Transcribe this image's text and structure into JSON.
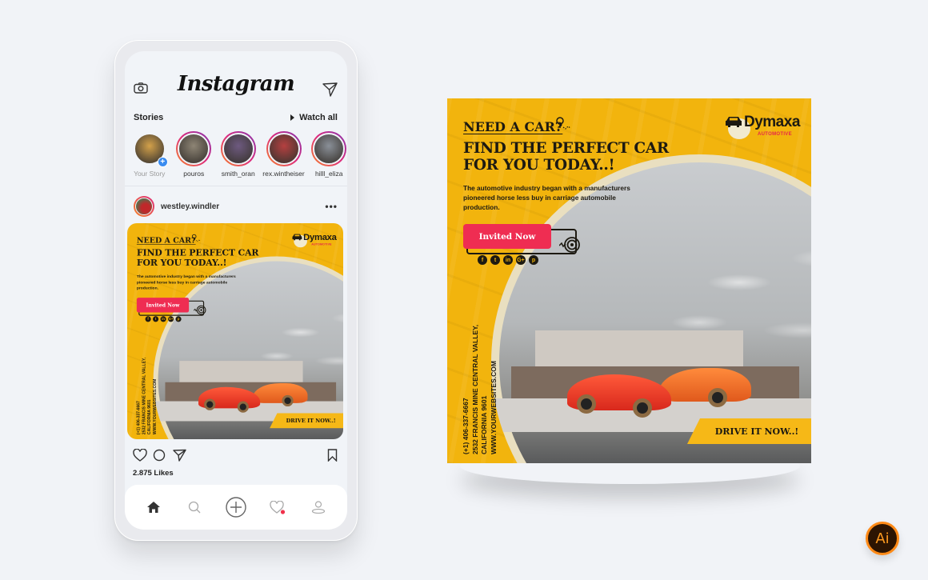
{
  "instagram": {
    "app_title": "Instagram",
    "stories_label": "Stories",
    "watch_all_label": "Watch all",
    "stories": [
      {
        "name": "Your Story",
        "own": true,
        "color": "#d3a14a"
      },
      {
        "name": "pouros",
        "own": false,
        "color": "#8e8575"
      },
      {
        "name": "smith_oran",
        "own": false,
        "color": "#6e5a80"
      },
      {
        "name": "rex.wintheiser",
        "own": false,
        "color": "#b54040"
      },
      {
        "name": "hilll_eliza",
        "own": false,
        "color": "#8a9098"
      }
    ],
    "post": {
      "username": "westley.windler",
      "more_label": "•••",
      "likes": "2.875 Likes"
    },
    "tabbar": [
      "home",
      "search",
      "new-post",
      "activity",
      "profile"
    ]
  },
  "design": {
    "heading_small": "NEED A CAR?",
    "heading_big_line1": "FIND THE PERFECT CAR",
    "heading_big_line2": "FOR YOU TODAY..!",
    "description": "The automotive industry began with a manufacturers pioneered horse less buy in carriage automobile production.",
    "cta_label": "Invited Now",
    "brand_name": "Dymaxa",
    "brand_sub": "AUTOMOTIVE",
    "socials": [
      "f",
      "t",
      "in",
      "G+",
      "p"
    ],
    "contact_phone": "(+1) 406-337-6667",
    "contact_address_line1": "2532 FRANCIS MINE CENTRAL VALLEY,",
    "contact_address_line2": "CALIFORNIA 9601",
    "contact_web": "WWW.YOURWEBSITES.COM",
    "drive_label": "DRIVE IT NOW..!",
    "colors": {
      "yellow": "#f2b40d",
      "cta": "#ef2d52",
      "dark": "#1d1a12"
    }
  },
  "badge": {
    "label": "Ai",
    "color": "#ff8a17"
  }
}
